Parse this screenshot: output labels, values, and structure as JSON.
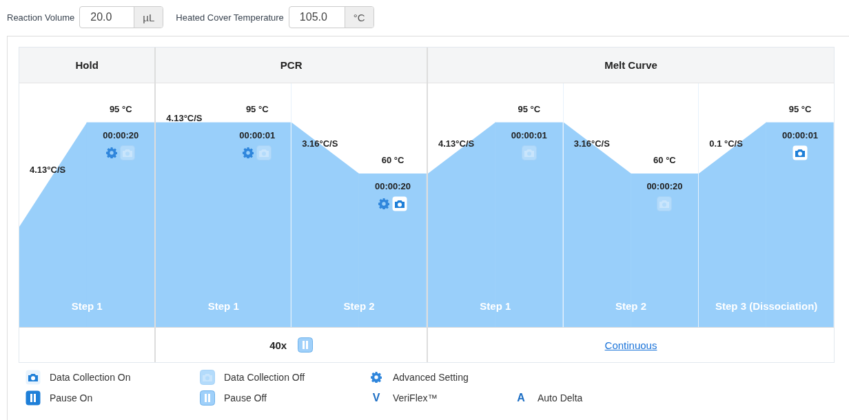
{
  "settings": [
    {
      "label": "Reaction Volume",
      "value": "20.0",
      "unit": "µL"
    },
    {
      "label": "Heated Cover Temperature",
      "value": "105.0",
      "unit": "°C"
    }
  ],
  "stages": [
    {
      "name": "Hold",
      "steps": [
        {
          "label": "Step 1",
          "temp": "95 °C",
          "time": "00:00:20",
          "rate": "4.13°C/S",
          "level": 0.84,
          "advanced": true,
          "data_collection": false
        }
      ]
    },
    {
      "name": "PCR",
      "footer": {
        "kind": "cycles",
        "text": "40x",
        "pause": false
      },
      "steps": [
        {
          "label": "Step 1",
          "temp": "95 °C",
          "time": "00:00:01",
          "rate": "4.13°C/S",
          "level": 0.84,
          "advanced": true,
          "data_collection": false
        },
        {
          "label": "Step 2",
          "temp": "60 °C",
          "time": "00:00:20",
          "rate": "3.16°C/S",
          "level": 0.63,
          "advanced": true,
          "data_collection": true
        }
      ]
    },
    {
      "name": "Melt Curve",
      "footer": {
        "kind": "link",
        "text": "Continuous"
      },
      "steps": [
        {
          "label": "Step 1",
          "temp": "95 °C",
          "time": "00:00:01",
          "rate": "4.13°C/S",
          "level": 0.84,
          "advanced": false,
          "data_collection": false
        },
        {
          "label": "Step 2",
          "temp": "60 °C",
          "time": "00:00:20",
          "rate": "3.16°C/S",
          "level": 0.63,
          "advanced": false,
          "data_collection": false
        },
        {
          "label": "Step 3 (Dissociation)",
          "temp": "95 °C",
          "time": "00:00:01",
          "rate": "0.1 °C/S",
          "level": 0.84,
          "advanced": false,
          "data_collection": true
        }
      ]
    }
  ],
  "legend": [
    [
      {
        "kind": "camera-on",
        "label": "Data Collection On"
      },
      {
        "kind": "camera-off",
        "label": "Data Collection Off"
      },
      {
        "kind": "gear",
        "label": "Advanced Setting"
      }
    ],
    [
      {
        "kind": "pause-on",
        "label": "Pause On"
      },
      {
        "kind": "pause-off",
        "label": "Pause Off"
      },
      {
        "kind": "letter",
        "symbol": "V",
        "label": "VeriFlex™"
      },
      {
        "kind": "letter",
        "symbol": "A",
        "label": "Auto Delta"
      }
    ]
  ]
}
